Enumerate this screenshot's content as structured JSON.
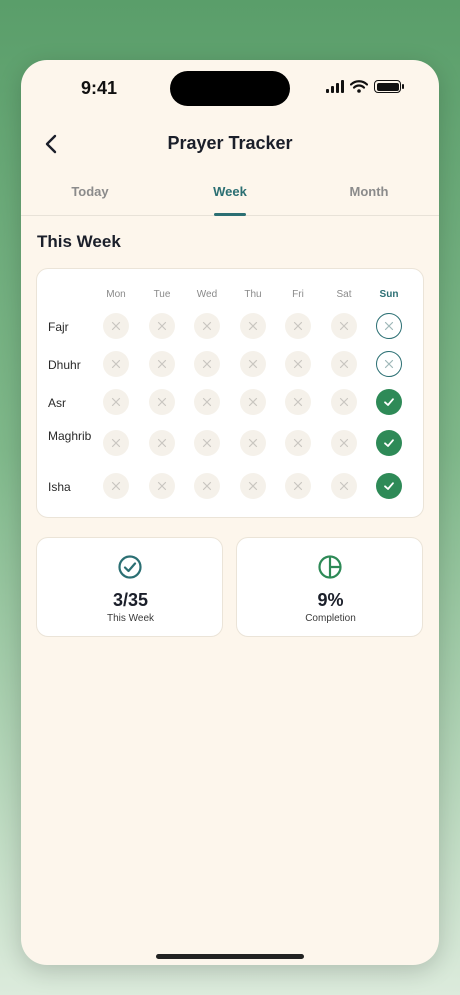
{
  "status_bar": {
    "time": "9:41"
  },
  "header": {
    "title": "Prayer Tracker"
  },
  "tabs": [
    {
      "label": "Today",
      "active": false
    },
    {
      "label": "Week",
      "active": true
    },
    {
      "label": "Month",
      "active": false
    }
  ],
  "section_title": "This Week",
  "days": [
    "Mon",
    "Tue",
    "Wed",
    "Thu",
    "Fri",
    "Sat",
    "Sun"
  ],
  "today_index": 6,
  "prayers": [
    {
      "name": "Fajr",
      "status": [
        "missed",
        "missed",
        "missed",
        "missed",
        "missed",
        "missed",
        "pending"
      ]
    },
    {
      "name": "Dhuhr",
      "status": [
        "missed",
        "missed",
        "missed",
        "missed",
        "missed",
        "missed",
        "pending"
      ]
    },
    {
      "name": "Asr",
      "status": [
        "missed",
        "missed",
        "missed",
        "missed",
        "missed",
        "missed",
        "done"
      ]
    },
    {
      "name": "Maghrib",
      "status": [
        "missed",
        "missed",
        "missed",
        "missed",
        "missed",
        "missed",
        "done"
      ]
    },
    {
      "name": "Isha",
      "status": [
        "missed",
        "missed",
        "missed",
        "missed",
        "missed",
        "missed",
        "done"
      ]
    }
  ],
  "stats": [
    {
      "value": "3/35",
      "label": "This Week",
      "icon": "check-circle-icon"
    },
    {
      "value": "9%",
      "label": "Completion",
      "icon": "pie-chart-icon"
    }
  ],
  "colors": {
    "accent": "#2b6f73",
    "done": "#2e8a57",
    "background": "#fdf6ec"
  }
}
